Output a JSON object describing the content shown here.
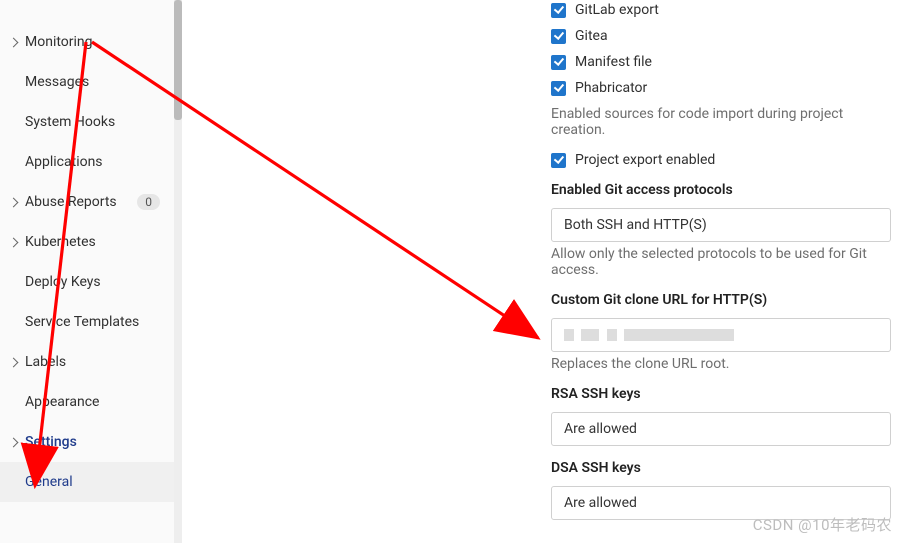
{
  "sidebar": {
    "items": [
      {
        "label": "Monitoring",
        "chevron": true
      },
      {
        "label": "Messages",
        "chevron": false
      },
      {
        "label": "System Hooks",
        "chevron": false
      },
      {
        "label": "Applications",
        "chevron": false
      },
      {
        "label": "Abuse Reports",
        "chevron": true,
        "badge": "0"
      },
      {
        "label": "Kubernetes",
        "chevron": true
      },
      {
        "label": "Deploy Keys",
        "chevron": false
      },
      {
        "label": "Service Templates",
        "chevron": false
      },
      {
        "label": "Labels",
        "chevron": true
      },
      {
        "label": "Appearance",
        "chevron": false
      },
      {
        "label": "Settings",
        "chevron": true,
        "cls": "settings"
      },
      {
        "label": "General",
        "chevron": false,
        "cls": "general"
      }
    ]
  },
  "import_sources": {
    "gitlab_export": "GitLab export",
    "gitea": "Gitea",
    "manifest": "Manifest file",
    "phabricator": "Phabricator",
    "help": "Enabled sources for code import during project creation."
  },
  "project_export_label": "Project export enabled",
  "git_protocols": {
    "label": "Enabled Git access protocols",
    "value": "Both SSH and HTTP(S)",
    "help": "Allow only the selected protocols to be used for Git access."
  },
  "clone_url": {
    "label": "Custom Git clone URL for HTTP(S)",
    "help": "Replaces the clone URL root."
  },
  "rsa_keys": {
    "label": "RSA SSH keys",
    "value": "Are allowed"
  },
  "dsa_keys": {
    "label": "DSA SSH keys",
    "value": "Are allowed"
  },
  "watermark": "CSDN @10年老码农"
}
